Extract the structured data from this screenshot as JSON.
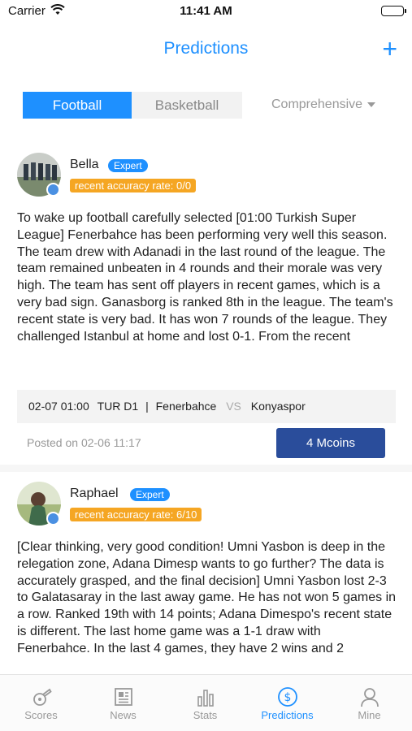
{
  "status_bar": {
    "carrier": "Carrier",
    "time": "11:41 AM"
  },
  "nav": {
    "title": "Predictions",
    "add_label": "+"
  },
  "filters": {
    "tabs": [
      "Football",
      "Basketball"
    ],
    "sort_label": "Comprehensive"
  },
  "posts": [
    {
      "name": "Bella",
      "badge": "Expert",
      "accuracy": "recent accuracy rate: 0/0",
      "content": "To wake up football carefully selected [01:00 Turkish Super League] Fenerbahce has been performing very well this season. The team drew with Adanadi in the last round of the league. The team remained unbeaten in 4 rounds and their morale was very high. The team has sent off players in recent games, which is a very bad sign. Ganasborg is ranked 8th in the league. The team's recent state is very bad. It has won 7 rounds of the league. They challenged Istanbul at home and lost 0-1. From the recent",
      "match": {
        "datetime": "02-07 01:00",
        "league": "TUR D1",
        "home": "Fenerbahce",
        "vs": "VS",
        "away": "Konyaspor"
      },
      "posted": "Posted on 02-06 11:17",
      "price": "4 Mcoins"
    },
    {
      "name": "Raphael",
      "badge": "Expert",
      "accuracy": "recent accuracy rate: 6/10",
      "content": "[Clear thinking, very good condition! Umni Yasbon is deep in the relegation zone, Adana Dimesp wants to go further? The data is accurately grasped, and the final decision] Umni Yasbon lost 2-3 to Galatasaray in the last away game. He has not won 5 games in a row. Ranked 19th with 14 points; Adana Dimespo's recent state is different. The last home game was a 1-1 draw with Fenerbahce. In the last 4 games, they have 2 wins and 2"
    }
  ],
  "tabbar": {
    "items": [
      {
        "label": "Scores",
        "icon": "whistle-icon"
      },
      {
        "label": "News",
        "icon": "newspaper-icon"
      },
      {
        "label": "Stats",
        "icon": "bar-chart-icon"
      },
      {
        "label": "Predictions",
        "icon": "dollar-circle-icon"
      },
      {
        "label": "Mine",
        "icon": "person-icon"
      }
    ],
    "active_index": 3
  },
  "colors": {
    "accent": "#1e90ff",
    "price_button": "#2a4d9b",
    "accuracy_badge": "#f5a623"
  }
}
